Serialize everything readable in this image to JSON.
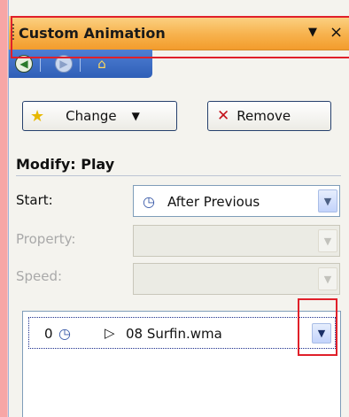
{
  "pane": {
    "title": "Custom Animation",
    "dropdown_glyph": "▼",
    "close_glyph": "×"
  },
  "nav": {
    "back_icon": "arrow-left-icon",
    "forward_icon": "arrow-right-icon",
    "home_icon": "home-icon"
  },
  "toolbar": {
    "change_label": "Change",
    "remove_label": "Remove"
  },
  "modify": {
    "heading": "Modify: Play",
    "start_label": "Start:",
    "start_value": "After Previous",
    "property_label": "Property:",
    "property_value": "",
    "speed_label": "Speed:",
    "speed_value": ""
  },
  "animation_list": {
    "items": [
      {
        "order": "0",
        "effect": "08 Surfin.wma"
      }
    ]
  },
  "colors": {
    "title_orange": "#f7b24d",
    "nav_blue": "#3a6ac4",
    "highlight_red": "#e0202a"
  }
}
